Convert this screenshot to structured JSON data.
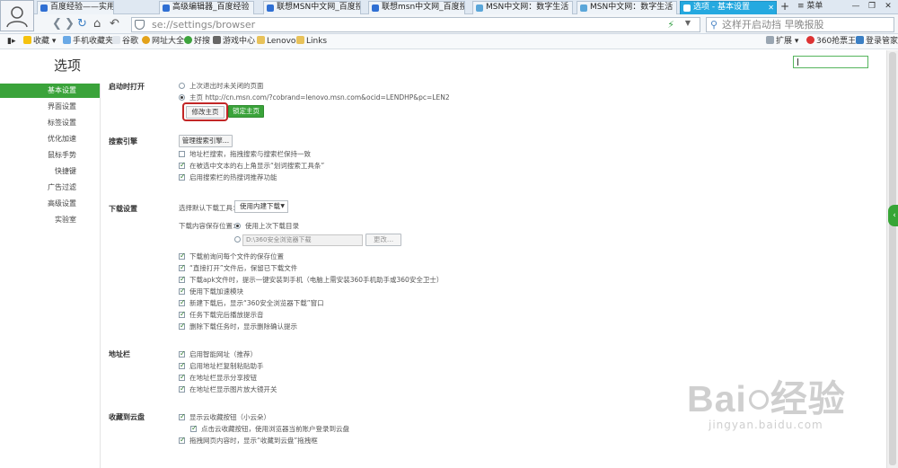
{
  "tabs": [
    {
      "label": "百度经验——实用生活",
      "color": "#2f6fd3"
    },
    {
      "label": "高级编辑器_百度经验",
      "color": "#2f6fd3"
    },
    {
      "label": "联想MSN中文网_百度搜",
      "color": "#2f6fd3"
    },
    {
      "label": "联想msn中文网_百度搜",
      "color": "#2f6fd3"
    },
    {
      "label": "MSN中文网：数字生活",
      "color": "#5aa6d9"
    },
    {
      "label": "MSN中文网：数字生活",
      "color": "#5aa6d9"
    },
    {
      "label": "选项 - 基本设置",
      "color": "#ffffff"
    }
  ],
  "tab_new": "+",
  "menu_label": "菜单",
  "window_buttons": [
    "—",
    "❐",
    "✕"
  ],
  "address": {
    "url": "se://settings/browser",
    "search_placeholder": "这样开启动挡 早晚报股"
  },
  "bookmarks": [
    {
      "label": "收藏",
      "icon": "star-icon"
    },
    {
      "label": "手机收藏夹",
      "icon": "phone-icon"
    },
    {
      "label": "谷歌",
      "icon": "page-icon"
    },
    {
      "label": "网址大全",
      "icon": "globe-icon"
    },
    {
      "label": "好搜",
      "icon": "search-icon"
    },
    {
      "label": "游戏中心",
      "icon": "gamepad-icon"
    },
    {
      "label": "Lenovo",
      "icon": "folder-icon"
    },
    {
      "label": "Links",
      "icon": "folder-icon"
    }
  ],
  "bookmarks_right": [
    "扩展",
    "360抢票王",
    "登录管家"
  ],
  "page_title": "选项",
  "sidebar": [
    "基本设置",
    "界面设置",
    "标签设置",
    "优化加速",
    "鼠标手势",
    "快捷键",
    "广告过滤",
    "高级设置",
    "实验室"
  ],
  "startup": {
    "heading": "启动时打开",
    "option1": "上次退出时未关闭的页面",
    "option2": "主页 http://cn.msn.com/?cobrand=lenovo.msn.com&ocid=LENDHP&pc=LEN2",
    "edit_home": "修改主页",
    "lock_home": "锁定主页"
  },
  "search_engine": {
    "heading": "搜索引擎",
    "manage_button": "管理搜索引擎...",
    "opt1": "地址栏搜索，拖拽搜索与搜索栏保持一致",
    "opt2": "在被选中文本的右上角显示“划词搜索工具条”",
    "opt3": "启用搜索栏的热搜词推荐功能"
  },
  "download": {
    "heading": "下载设置",
    "tool_label": "选择默认下载工具：",
    "tool_value": "使用内建下载",
    "location_label": "下载内容保存位置：",
    "loc_opt1": "使用上次下载目录",
    "path_value": "D:\\360安全浏览器下载",
    "change_button": "更改...",
    "opts": [
      "下载前询问每个文件的保存位置",
      "“直接打开”文件后，保留已下载文件",
      "下载apk文件时，提示一键安装到手机（电脑上需安装360手机助手或360安全卫士）",
      "使用下载加速模块",
      "新建下载后，显示“360安全浏览器下载”窗口",
      "任务下载完后播放提示音",
      "删除下载任务时，显示删除确认提示"
    ]
  },
  "addressbar": {
    "heading": "地址栏",
    "opts": [
      "启用智能网址（推荐）",
      "启用地址栏复制粘贴助手",
      "在地址栏显示分享按钮",
      "在地址栏显示图片放大镜开关"
    ]
  },
  "cloud": {
    "heading": "收藏到云盘",
    "opt1": "显示云收藏按钮（小云朵）",
    "opt1_sub": "点击云收藏按钮，使用浏览器当前账户登录到云盘",
    "opt2": "拖拽网页内容时，显示“收藏到云盘”拖拽框"
  },
  "watermark": {
    "main": "Bai",
    "main2": "经验",
    "url": "jingyan.baidu.com"
  },
  "colors": {
    "accent_green": "#3aa33a",
    "active_tab": "#25a9e0",
    "highlight_red": "#c22626"
  }
}
